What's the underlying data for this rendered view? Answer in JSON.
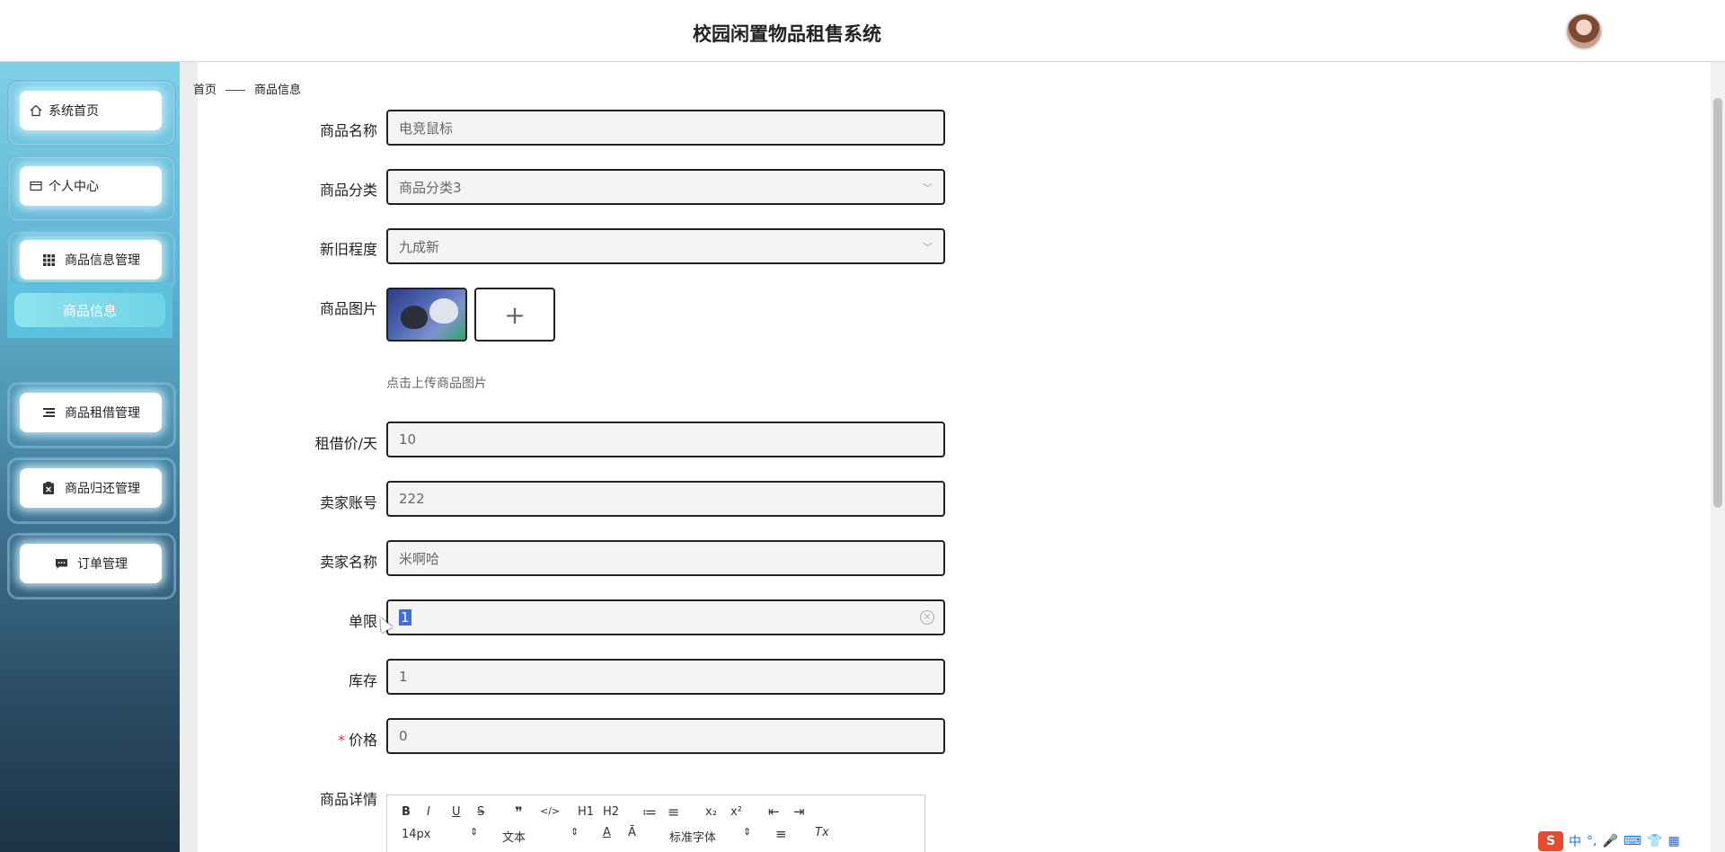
{
  "header": {
    "title": "校园闲置物品租售系统"
  },
  "sidebar": {
    "items": [
      {
        "label": "系统首页",
        "icon": "home-icon"
      },
      {
        "label": "个人中心",
        "icon": "card-icon"
      },
      {
        "label": "商品信息管理",
        "icon": "grid-icon"
      },
      {
        "label": "商品信息",
        "icon": ""
      },
      {
        "label": "商品租借管理",
        "icon": "list-icon"
      },
      {
        "label": "商品归还管理",
        "icon": "clipboard-icon"
      },
      {
        "label": "订单管理",
        "icon": "chat-icon"
      }
    ]
  },
  "breadcrumb": {
    "home": "首页",
    "current": "商品信息"
  },
  "form": {
    "name": {
      "label": "商品名称",
      "value": "电竞鼠标"
    },
    "category": {
      "label": "商品分类",
      "value": "商品分类3"
    },
    "condition": {
      "label": "新旧程度",
      "value": "九成新"
    },
    "image": {
      "label": "商品图片",
      "hint": "点击上传商品图片",
      "add": "+"
    },
    "rent_price": {
      "label": "租借价/天",
      "value": "10"
    },
    "seller_account": {
      "label": "卖家账号",
      "value": "222"
    },
    "seller_name": {
      "label": "卖家名称",
      "value": "米啊哈"
    },
    "limit": {
      "label": "单限",
      "value": "1"
    },
    "stock": {
      "label": "库存",
      "value": "1"
    },
    "price": {
      "label": "价格",
      "value": "0",
      "required_mark": "*"
    },
    "detail": {
      "label": "商品详情"
    }
  },
  "editor": {
    "toolbar_row1": [
      "B",
      "I",
      "U",
      "S",
      "❞",
      "</>",
      "H1",
      "H2",
      "≔",
      "≡",
      "x₂",
      "x²",
      "⇤",
      "⇥"
    ],
    "font_size": "14px",
    "text_type": "文本",
    "font_family": "标准字体",
    "extra": [
      "A",
      "Ā",
      "≡",
      "Tx"
    ]
  },
  "ime": {
    "lang": "中",
    "punct": "°,"
  }
}
